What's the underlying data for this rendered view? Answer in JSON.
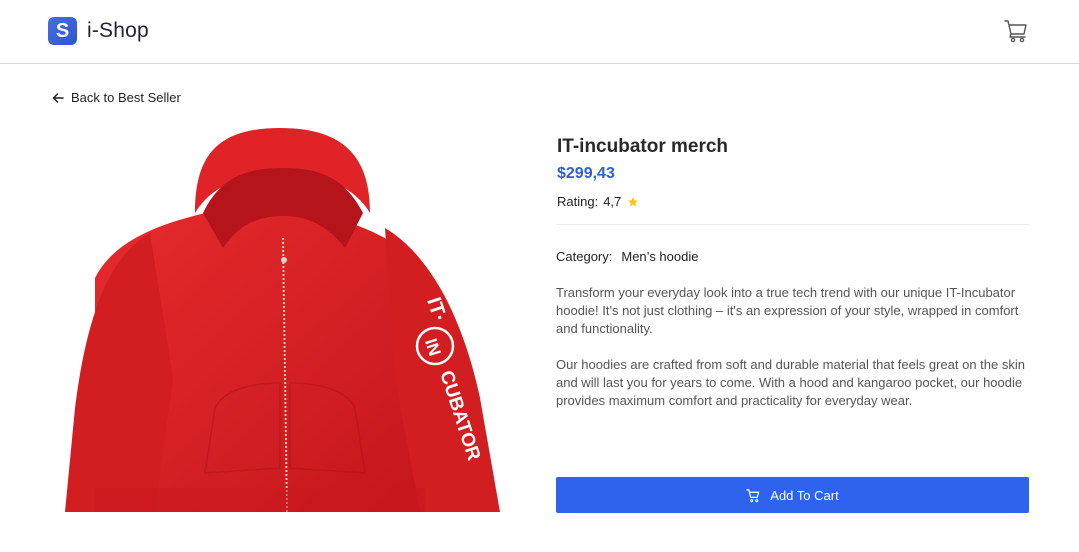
{
  "header": {
    "logo_letter": "S",
    "logo_text": "i-Shop",
    "cart_icon": "cart-icon"
  },
  "nav": {
    "back_label": "Back to Best Seller",
    "back_icon": "arrow-left-icon"
  },
  "product": {
    "title": "IT-incubator merch",
    "price": "$299,43",
    "rating_label": "Rating:",
    "rating_value": "4,7",
    "rating_icon": "star-icon",
    "category_label": "Category:",
    "category_value": "Men’s hoodie",
    "description_1": "Transform your everyday look into a true tech trend with our unique IT-Incubator hoodie! It's not just clothing – it's an expression of your style, wrapped in comfort and functionality.",
    "description_2": "Our hoodies are crafted from soft and durable material that feels great on the skin and will last you for years to come. With a hood and kangaroo pocket, our hoodie provides maximum comfort and practicality for everyday wear.",
    "image_print_text": "IT-INCUBATOR",
    "image_print_top": "IT·",
    "image_print_circle": "IN",
    "image_print_bottom": "CUBATOR"
  },
  "actions": {
    "add_to_cart_label": "Add To Cart"
  },
  "colors": {
    "accent": "#2f63ee",
    "price": "#2f5fd3",
    "hoodie": "#d81e22",
    "star": "#f5c518"
  }
}
